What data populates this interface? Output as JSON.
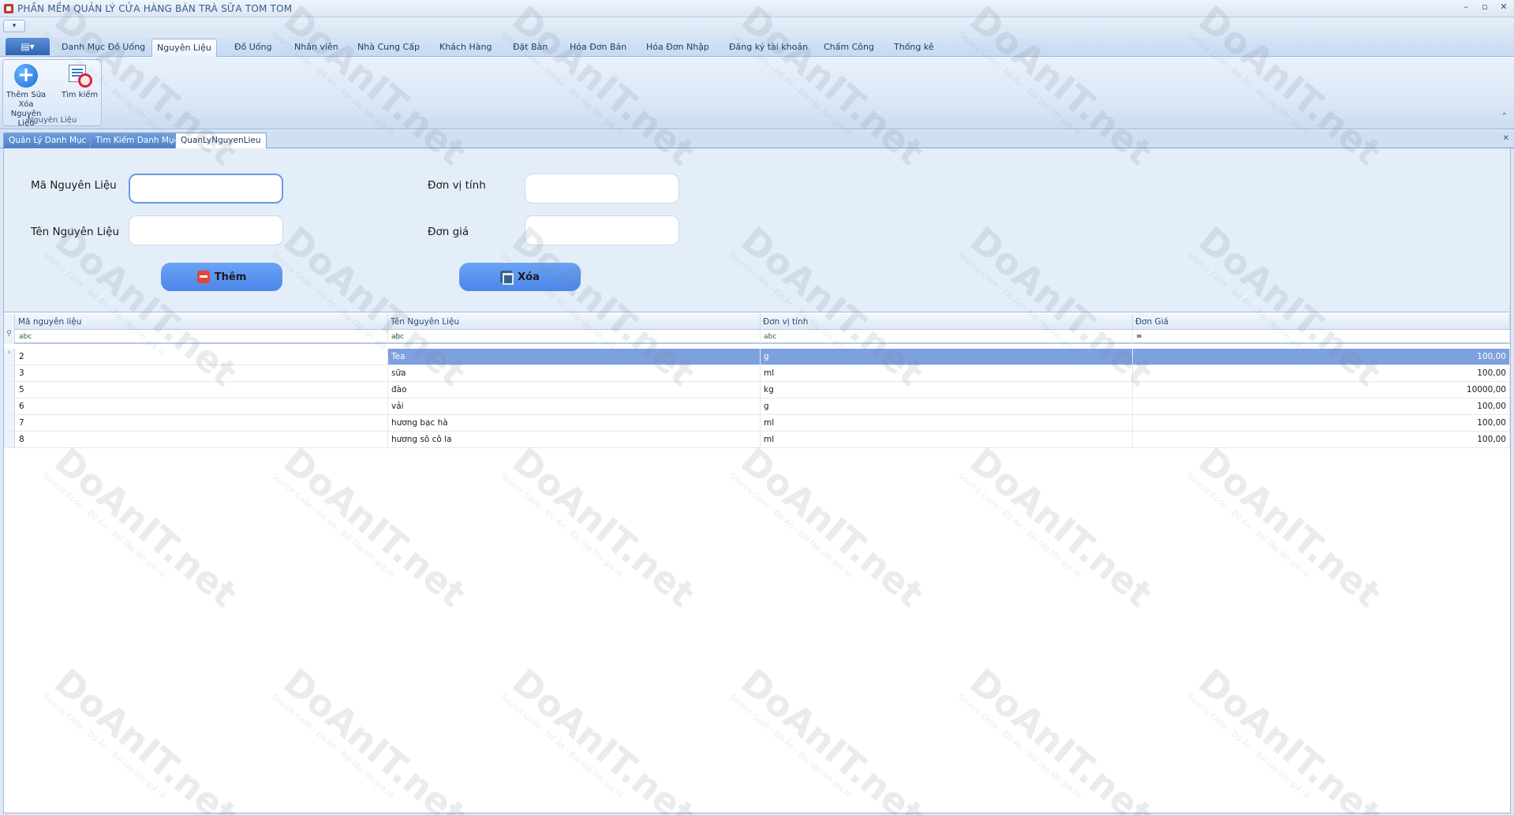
{
  "window": {
    "title": "PHẦN MỀM QUẢN LÝ CỬA HÀNG BÁN TRÀ SỮA TOM TOM",
    "controls": [
      "–",
      "▫",
      "✕"
    ]
  },
  "ribbon": {
    "tabs": [
      "Danh Mục Đồ Uống",
      "Nguyên Liệu",
      "Đồ Uống",
      "Nhân viên",
      "Nhà Cung Cấp",
      "Khách Hàng",
      "Đặt Bàn",
      "Hóa Đơn Bán",
      "Hóa Đơn Nhập",
      "Đăng ký tài khoản",
      "Chấm Công",
      "Thống kê"
    ],
    "active_tab": "Nguyên Liệu",
    "group_caption": "Nguyên Liệu",
    "buttons": {
      "add_edit_delete": "Thêm Sửa Xóa Nguyên Liệu",
      "search": "Tìm kiếm"
    }
  },
  "mdi_tabs": [
    "Quản Lý Danh Mục",
    "Tìm Kiếm Danh Mục",
    "QuanLyNguyenLieu"
  ],
  "form": {
    "ma_label": "Mã Nguyên Liệu",
    "ten_label": "Tên Nguyên Liệu",
    "donvi_label": "Đơn vị tính",
    "dongia_label": "Đơn giá",
    "ma_value": "",
    "ten_value": "",
    "donvi_value": "",
    "dongia_value": "",
    "add_button": "Thêm",
    "delete_button": "Xóa"
  },
  "grid": {
    "columns": [
      "Mã nguyên liệu",
      "Tên Nguyên Liệu",
      "Đơn vị tính",
      "Đơn Giá"
    ],
    "filter_glyph": "abc",
    "filter_eq": "=",
    "rows": [
      [
        "2",
        "Tea",
        "g",
        "100,00"
      ],
      [
        "3",
        "sữa",
        "ml",
        "100,00"
      ],
      [
        "5",
        "đào",
        "kg",
        "10000,00"
      ],
      [
        "6",
        "vải",
        "g",
        "100,00"
      ],
      [
        "7",
        "hương bạc hà",
        "ml",
        "100,00"
      ],
      [
        "8",
        "hương sô cô la",
        "ml",
        "100,00"
      ]
    ],
    "selected_row": 0
  },
  "watermark": {
    "text": "DoAnIT.net",
    "sub": "Source Code - Đồ Án - Bài tập lớn giá rẻ"
  },
  "colors": {
    "accent": "#4b86ea",
    "selection": "#7da0de",
    "ribbon_bg": "#dce8f7"
  }
}
